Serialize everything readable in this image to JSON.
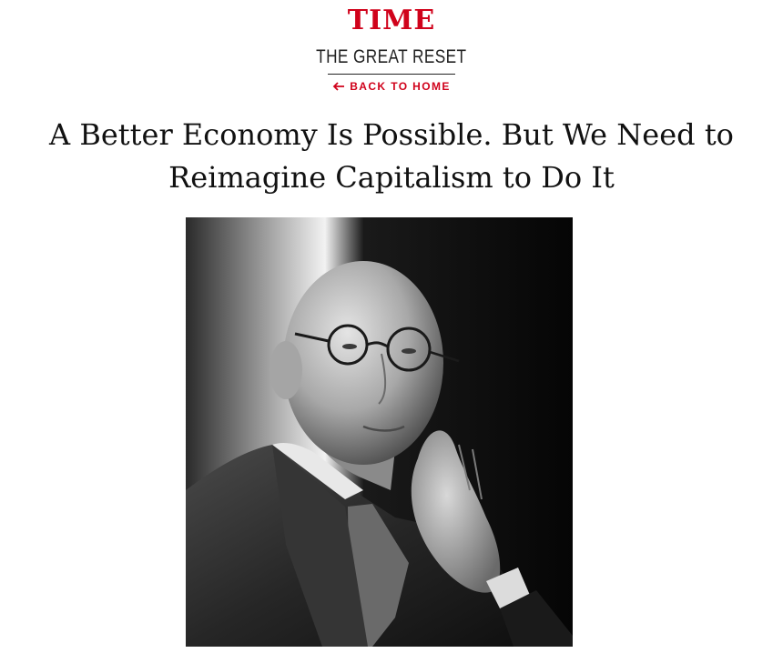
{
  "header": {
    "logo_text": "TIME",
    "section_title": "THE GREAT RESET",
    "back_label": "BACK TO HOME"
  },
  "article": {
    "headline_line1": "A Better Economy Is Possible. But We Need to",
    "headline_line2": "Reimagine Capitalism to Do It"
  },
  "colors": {
    "brand_red": "#d0021b",
    "text_dark": "#111111"
  },
  "icons": {
    "back": "arrow-left-icon"
  }
}
